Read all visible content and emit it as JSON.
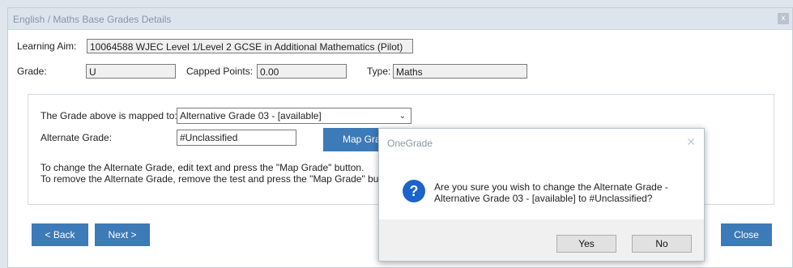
{
  "window": {
    "title": "English / Maths Base Grades Details",
    "close_glyph": "x"
  },
  "learning_aim": {
    "label": "Learning Aim:",
    "value": "10064588 WJEC Level 1/Level 2 GCSE in Additional Mathematics (Pilot)"
  },
  "grade": {
    "label": "Grade:",
    "value": "U"
  },
  "capped_points": {
    "label": "Capped Points:",
    "value": "0.00"
  },
  "type": {
    "label": "Type:",
    "value": "Maths"
  },
  "mapping": {
    "mapped_label": "The Grade above is mapped to:",
    "mapped_value": "Alternative Grade 03  - [available]",
    "alternate_label": "Alternate Grade:",
    "alternate_value": "#Unclassified",
    "map_button": "Map Grade",
    "help1": "To change the Alternate Grade, edit text and press the \"Map Grade\" button.",
    "help2": "To remove the Alternate Grade, remove the test and press the \"Map Grade\" button."
  },
  "nav": {
    "back": "< Back",
    "next": "Next >",
    "close": "Close"
  },
  "dialog": {
    "title": "OneGrade",
    "close_glyph": "✕",
    "icon_glyph": "?",
    "line1": "Are you sure you wish to change the Alternate Grade -",
    "line2": "Alternative Grade 03  - [available] to #Unclassified?",
    "yes": "Yes",
    "no": "No"
  },
  "colors": {
    "accent": "#3d7ab8",
    "question_icon": "#1a63c8"
  }
}
